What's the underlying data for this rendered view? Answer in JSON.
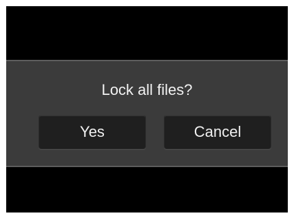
{
  "dialog": {
    "prompt": "Lock all files?",
    "buttons": {
      "yes_label": "Yes",
      "cancel_label": "Cancel"
    }
  },
  "colors": {
    "screen_background": "#000000",
    "dialog_background": "#3b3b3b",
    "button_background": "#1f1f1f",
    "text": "#f0f0f0"
  }
}
